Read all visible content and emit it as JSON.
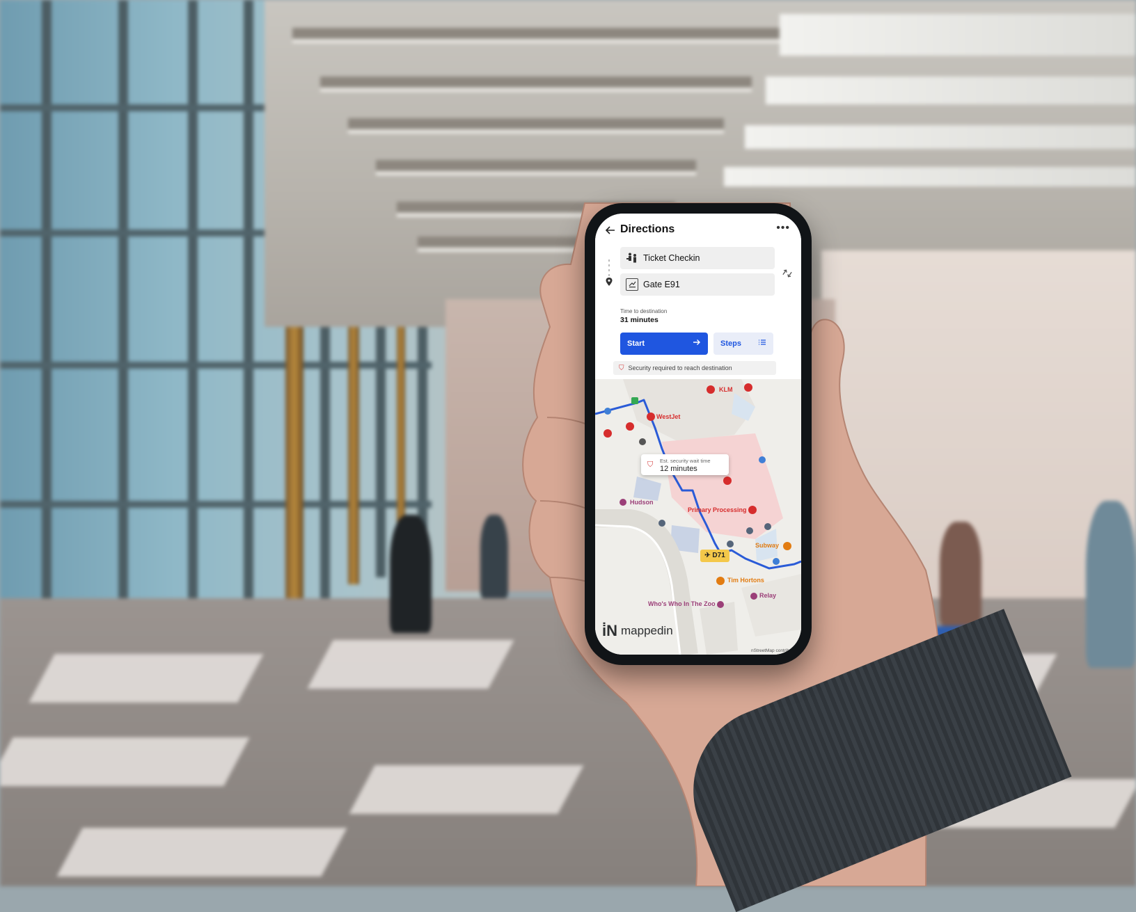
{
  "app": {
    "title": "Directions",
    "more_icon": "more-icon",
    "back_icon": "back-arrow-icon"
  },
  "route": {
    "origin": "Ticket Checkin",
    "origin_icon": "ticket-counter-icon",
    "destination": "Gate E91",
    "destination_icon": "gate-icon",
    "swap_icon": "swap-icon"
  },
  "summary": {
    "time_label": "Time to destination",
    "time_value": "31 minutes"
  },
  "actions": {
    "start_label": "Start",
    "steps_label": "Steps"
  },
  "notice": {
    "text": "Security required to reach destination"
  },
  "map": {
    "tooltip_label": "Est. security wait time",
    "tooltip_value": "12 minutes",
    "gate": "D71",
    "pois": {
      "klm": "KLM",
      "westjet": "WestJet",
      "hudson": "Hudson",
      "primary_processing": "Primary Processing",
      "subway": "Subway",
      "tim_hortons": "Tim Hortons",
      "relay": "Relay",
      "whos_who": "Who's Who In The Zoo"
    },
    "logo": "mappedin",
    "attribution": "nStreetMap contributo"
  },
  "colors": {
    "accent": "#1f56e0",
    "route": "#2a5bd7",
    "security_red": "#d43b3b",
    "food_orange": "#e27c12",
    "shop_purple": "#9b3f78"
  }
}
